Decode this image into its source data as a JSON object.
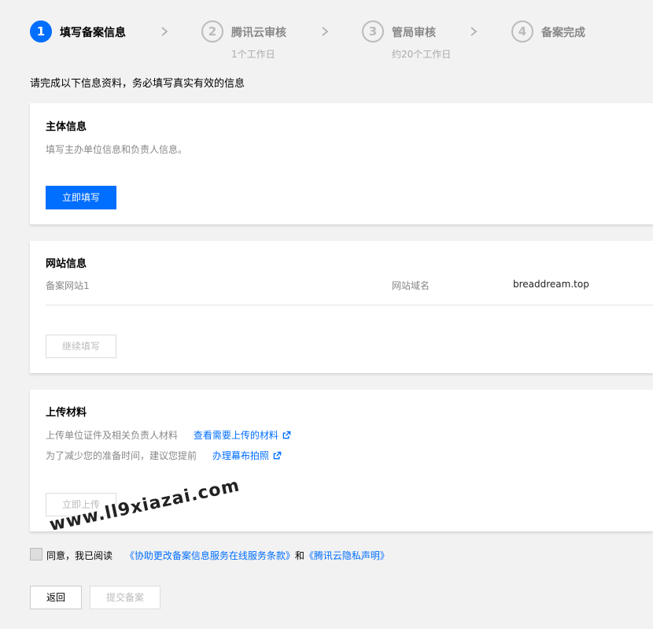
{
  "steps": [
    {
      "num": "1",
      "title": "填写备案信息",
      "sub": ""
    },
    {
      "num": "2",
      "title": "腾讯云审核",
      "sub": "1个工作日"
    },
    {
      "num": "3",
      "title": "管局审核",
      "sub": "约20个工作日"
    },
    {
      "num": "4",
      "title": "备案完成",
      "sub": ""
    }
  ],
  "notice": "请完成以下信息资料，务必填写真实有效的信息",
  "subject": {
    "title": "主体信息",
    "desc": "填写主办单位信息和负责人信息。",
    "button": "立即填写"
  },
  "website": {
    "title": "网站信息",
    "site_label": "备案网站1",
    "domain_label": "网站域名",
    "domain_value": "breaddream.top",
    "button": "继续填写"
  },
  "upload": {
    "title": "上传材料",
    "line1_text": "上传单位证件及相关负责人材料",
    "line1_link": "查看需要上传的材料",
    "line2_text": "为了减少您的准备时间，建议您提前",
    "line2_link": "办理幕布拍照",
    "button": "立即上传"
  },
  "agreement": {
    "prefix": "同意，我已阅读",
    "link1": "《协助更改备案信息服务在线服务条款》",
    "and": "和",
    "link2": "《腾讯云隐私声明》"
  },
  "footer": {
    "back": "返回",
    "submit": "提交备案"
  },
  "watermark": "www.ll9xiazai.com",
  "colors": {
    "accent": "#006eff",
    "background": "#f2f2f2"
  }
}
